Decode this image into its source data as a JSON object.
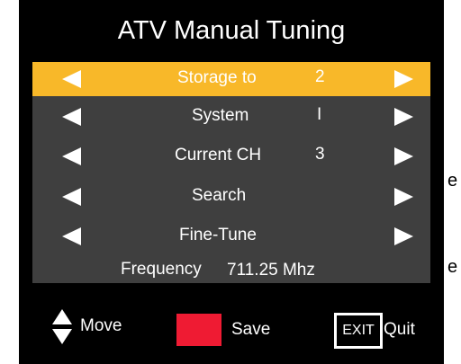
{
  "page": {
    "side_glyphs": [
      "e",
      "e"
    ]
  },
  "osd": {
    "title": "ATV Manual Tuning",
    "rows": [
      {
        "label": "Storage to",
        "value": "2",
        "selected": true
      },
      {
        "label": "System",
        "value": "I",
        "selected": false
      },
      {
        "label": "Current CH",
        "value": "3",
        "selected": false
      },
      {
        "label": "Search",
        "value": "",
        "selected": false
      },
      {
        "label": "Fine-Tune",
        "value": "",
        "selected": false
      }
    ],
    "frequency": {
      "label": "Frequency",
      "value": "711.25 Mhz"
    },
    "footer": {
      "move_label": "Move",
      "save_label": "Save",
      "exit_key_label": "EXIT",
      "quit_label": "Quit"
    },
    "colors": {
      "background": "#000000",
      "panel": "#3f3f3f",
      "highlight": "#f8b829",
      "save_key": "#ef1b33",
      "text": "#ffffff"
    },
    "icons": {
      "left": "triangle-left-icon",
      "right": "triangle-right-icon",
      "move": "up-down-triangles-icon"
    }
  }
}
